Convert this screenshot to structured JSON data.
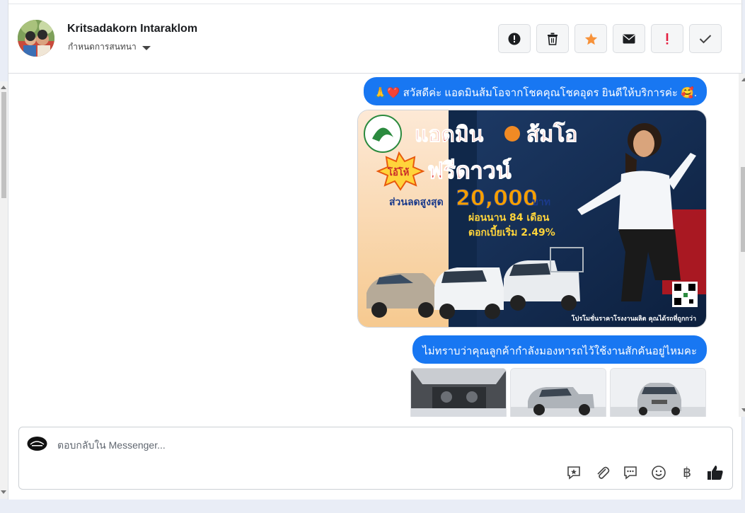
{
  "header": {
    "contact_name": "Kritsadakorn Intaraklom",
    "assign_label": "กำหนดการสนทนา",
    "actions": [
      {
        "icon": "alert-circle-icon",
        "label": "report"
      },
      {
        "icon": "trash-icon",
        "label": "delete"
      },
      {
        "icon": "star-icon",
        "label": "star"
      },
      {
        "icon": "envelope-icon",
        "label": "mark unread"
      },
      {
        "icon": "exclamation-icon",
        "label": "spam"
      },
      {
        "icon": "check-icon",
        "label": "done"
      }
    ]
  },
  "messages": {
    "greeting": "🙏❤️ สวัสดีค่ะ แอดมินส้มโอจากโชคคุณโชคอุดร ยินดีให้บริการค่ะ 🥰.",
    "question": "ไม่ทราบว่าคุณลูกค้ากำลังมองหารถไว้ใช้งานสักคันอยู่ไหมคะ"
  },
  "promo": {
    "title_admin": "แอดมิน",
    "title_name": "ส้มโอ",
    "badge": "โอ้โห้",
    "headline": "ฟรีดาวน์",
    "discount_label": "ส่วนลดสูงสุด",
    "discount_value": "20,000",
    "discount_unit": "บาท",
    "installment": "ผ่อนนาน 84 เดือน",
    "interest": "ดอกเบี้ยเริ่ม 2.49%",
    "footer": "โปรโมชั่นราคาโรงงานผลิต คุณได้รถที่ถูกกว่า"
  },
  "composer": {
    "placeholder": "ตอบกลับใน Messenger...",
    "tools": [
      "sticker-icon",
      "attachment-icon",
      "saved-reply-icon",
      "emoji-icon",
      "baht-icon",
      "like-icon"
    ],
    "baht_symbol": "฿"
  },
  "colors": {
    "bubble": "#1877f2",
    "star": "#f7923a",
    "spam": "#e41e3f"
  }
}
